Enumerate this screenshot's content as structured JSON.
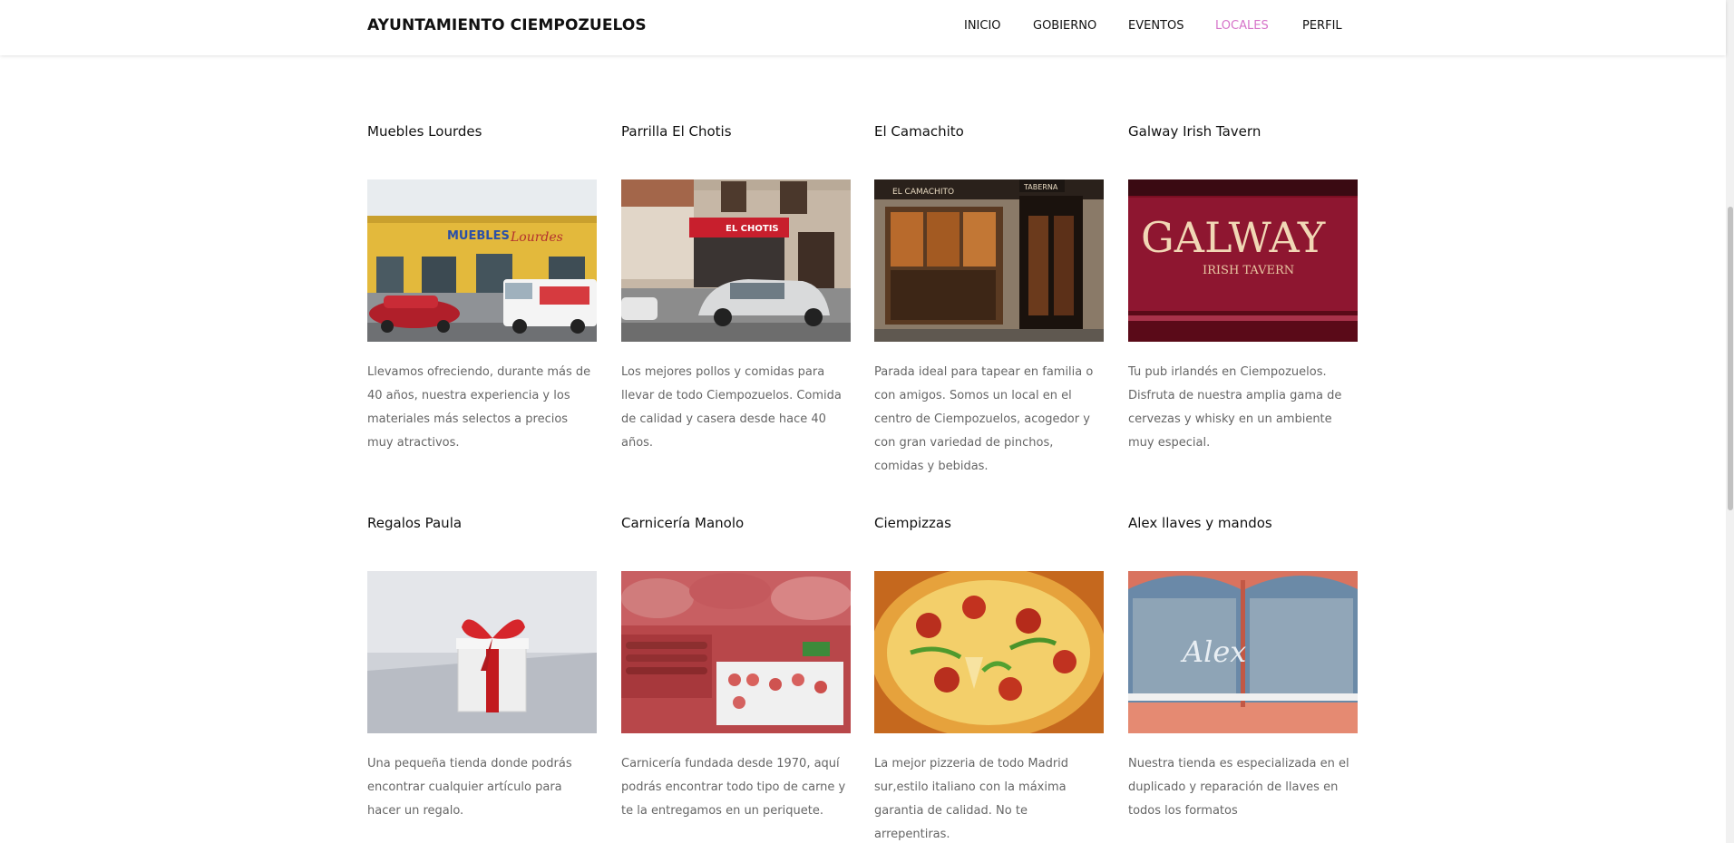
{
  "header": {
    "brand": "AYUNTAMIENTO CIEMPOZUELOS",
    "nav": [
      {
        "label": "INICIO",
        "active": false
      },
      {
        "label": "GOBIERNO",
        "active": false
      },
      {
        "label": "EVENTOS",
        "active": false
      },
      {
        "label": "LOCALES",
        "active": true
      },
      {
        "label": "PERFIL",
        "active": false
      }
    ],
    "active_color": "#d673c9"
  },
  "locales": [
    {
      "title": "Muebles Lourdes",
      "image": "furniture-store-facade",
      "description": "Llevamos ofreciendo, durante más de 40 años, nuestra experiencia y los materiales más selectos a precios muy atractivos."
    },
    {
      "title": "Parrilla El Chotis",
      "image": "grill-restaurant-facade",
      "description": "Los mejores pollos y comidas para llevar de todo Ciempozuelos. Comida de calidad y casera desde hace 40 años."
    },
    {
      "title": "El Camachito",
      "image": "tapas-bar-facade",
      "description": "Parada ideal para tapear en familia o con amigos. Somos un local en el centro de Ciempozuelos, acogedor y con gran variedad de pinchos, comidas y bebidas."
    },
    {
      "title": "Galway Irish Tavern",
      "image": "irish-pub-sign",
      "description": "Tu pub irlandés en Ciempozuelos. Disfruta de nuestra amplia gama de cervezas y whisky en un ambiente muy especial."
    },
    {
      "title": "Regalos Paula",
      "image": "gift-box",
      "description": "Una pequeña tienda donde podrás encontrar cualquier artículo para hacer un regalo."
    },
    {
      "title": "Carnicería Manolo",
      "image": "butcher-meat-display",
      "description": "Carnicería fundada desde 1970, aquí podrás encontrar todo tipo de carne y te la entregamos en un periquete."
    },
    {
      "title": "Ciempizzas",
      "image": "pizza",
      "description": "La mejor pizzeria de todo Madrid sur,estilo italiano con la máxima garantia de calidad. No te arrepentiras."
    },
    {
      "title": "Alex llaves y mandos",
      "image": "key-shop-window",
      "description": "Nuestra tienda es especializada en el duplicado y reparación de llaves en todos los formatos"
    }
  ],
  "image_text": {
    "muebles_sign_1": "MUEBLES",
    "muebles_sign_2": "Lourdes",
    "chotis_sign": "EL CHOTIS",
    "camachito_sign": "EL CAMACHITO",
    "camachito_taberna": "TABERNA",
    "galway_sign": "GALWAY",
    "galway_sub": "IRISH TAVERN",
    "alex_sign": "Alex"
  }
}
